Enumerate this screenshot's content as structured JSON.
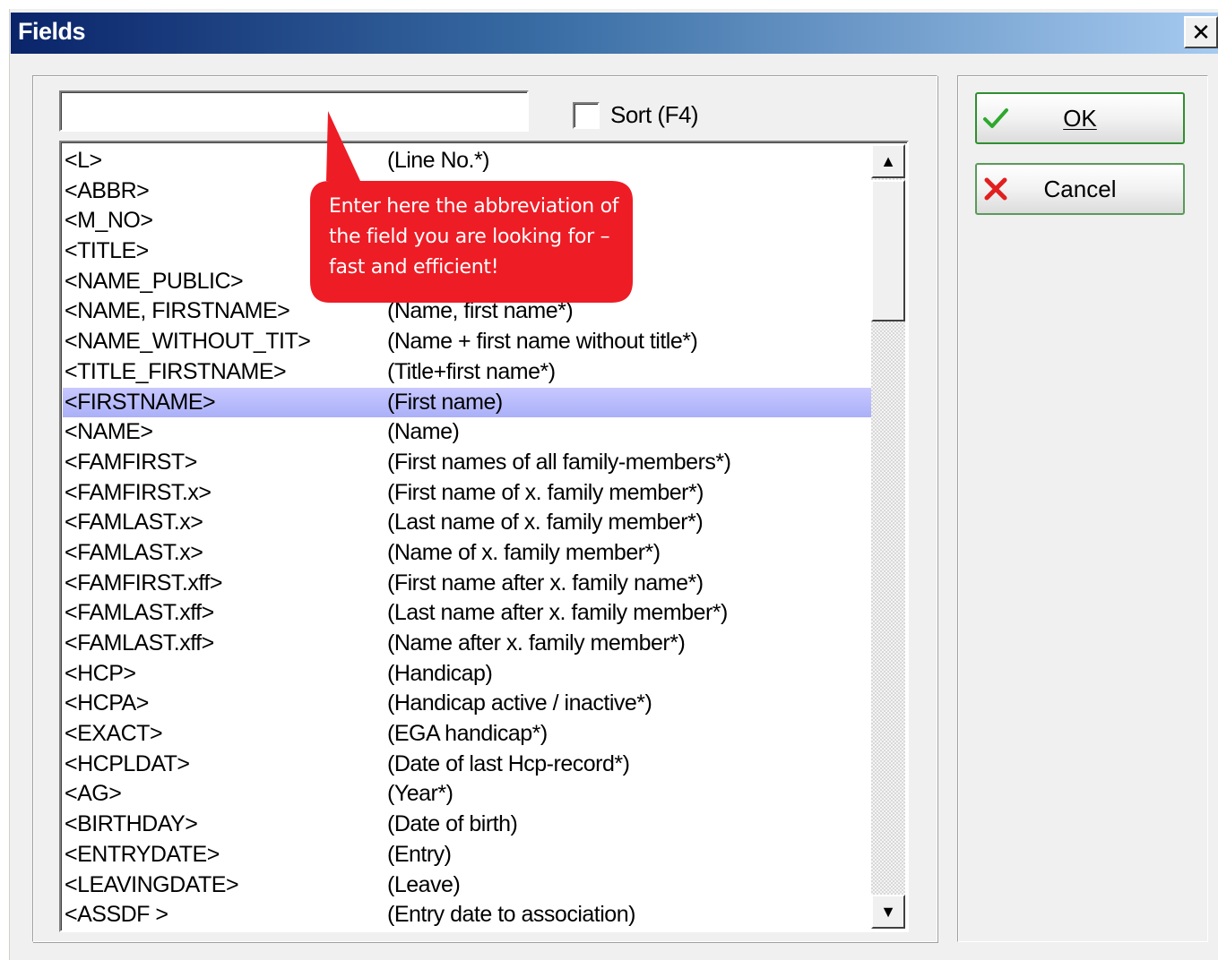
{
  "window": {
    "title": "Fields",
    "close_glyph": "✕"
  },
  "search": {
    "value": "",
    "placeholder": ""
  },
  "sort": {
    "label": "Sort (F4)",
    "checked": false
  },
  "buttons": {
    "ok_label": "OK",
    "ok_icon": "checkmark-icon",
    "ok_icon_color": "#2ea82e",
    "cancel_label": "Cancel",
    "cancel_icon": "x-icon",
    "cancel_icon_color": "#e02020"
  },
  "callout": {
    "text": "Enter here the abbreviation of the field you are looking for – fast and efficient!",
    "color": "#ee1c25"
  },
  "list": {
    "selected_index": 8,
    "rows": [
      {
        "code": "<L>",
        "desc": "(Line No.*)"
      },
      {
        "code": "<ABBR>",
        "desc": ""
      },
      {
        "code": "<M_NO>",
        "desc": ""
      },
      {
        "code": "<TITLE>",
        "desc": ""
      },
      {
        "code": "<NAME_PUBLIC>",
        "desc": ""
      },
      {
        "code": "<NAME, FIRSTNAME>",
        "desc": "(Name, first name*)"
      },
      {
        "code": "<NAME_WITHOUT_TIT>",
        "desc": "(Name + first name without title*)"
      },
      {
        "code": "<TITLE_FIRSTNAME>",
        "desc": "(Title+first name*)"
      },
      {
        "code": "<FIRSTNAME>",
        "desc": "(First name)"
      },
      {
        "code": "<NAME>",
        "desc": "(Name)"
      },
      {
        "code": "<FAMFIRST>",
        "desc": "(First names of all family-members*)"
      },
      {
        "code": "<FAMFIRST.x>",
        "desc": "(First name of x. family member*)"
      },
      {
        "code": "<FAMLAST.x>",
        "desc": "(Last name of x. family member*)"
      },
      {
        "code": "<FAMLAST.x>",
        "desc": "(Name of x. family member*)"
      },
      {
        "code": "<FAMFIRST.xff>",
        "desc": "(First name after x. family name*)"
      },
      {
        "code": "<FAMLAST.xff>",
        "desc": "(Last name after x. family member*)"
      },
      {
        "code": "<FAMLAST.xff>",
        "desc": "(Name after x. family member*)"
      },
      {
        "code": "<HCP>",
        "desc": "(Handicap)"
      },
      {
        "code": "<HCPA>",
        "desc": "(Handicap active / inactive*)"
      },
      {
        "code": "<EXACT>",
        "desc": "(EGA handicap*)"
      },
      {
        "code": "<HCPLDAT>",
        "desc": "(Date of last Hcp-record*)"
      },
      {
        "code": "<AG>",
        "desc": "(Year*)"
      },
      {
        "code": "<BIRTHDAY>",
        "desc": "(Date of birth)"
      },
      {
        "code": "<ENTRYDATE>",
        "desc": "(Entry)"
      },
      {
        "code": "<LEAVINGDATE>",
        "desc": "(Leave)"
      },
      {
        "code": "<ASSDF >",
        "desc": "(Entry date to association)"
      }
    ]
  }
}
